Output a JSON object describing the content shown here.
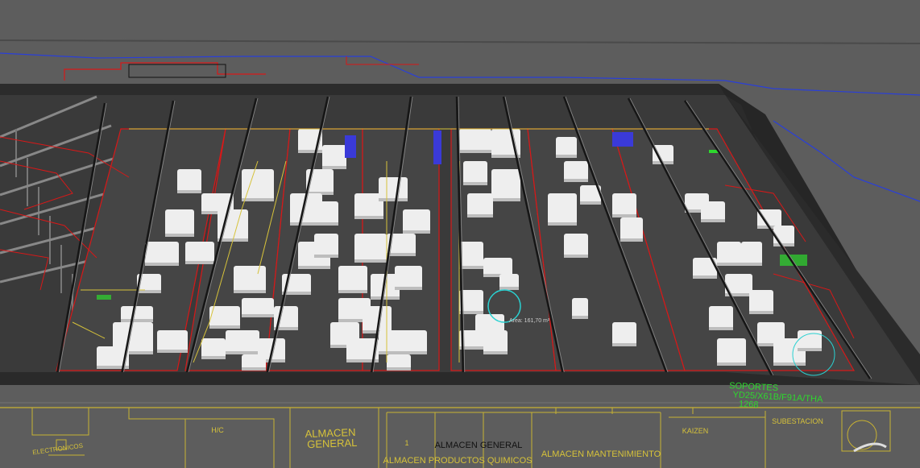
{
  "viewport": {
    "background": "#5d5d5d",
    "floor_color": "#3a3a3a",
    "wall_color": "#2a2a2a",
    "machine_color": "#eeeeee",
    "cad_red": "#d81818",
    "cad_yellow": "#d6c23a",
    "cad_blue": "#2a3fd8",
    "cad_green": "#2ed82e"
  },
  "labels": {
    "almacen_general_big": "ALMACEN\nGENERAL",
    "almacen_general_small": "ALMACEN GENERAL",
    "almacen_productos_quimicos": "ALMACEN PRODUCTOS QUIMICOS",
    "almacen_mantenimiento": "ALMACEN MANTENIMIENTO",
    "kaizen": "KAIZEN",
    "subestacion": "SUBESTACION",
    "soportes": "SOPORTES\nYD25/X61B/F91A/THA\n1268",
    "hvc": "H/C",
    "electronicos": "ELECTRONICOS",
    "area": "Area: 161,70 m²",
    "number_1": "1"
  }
}
